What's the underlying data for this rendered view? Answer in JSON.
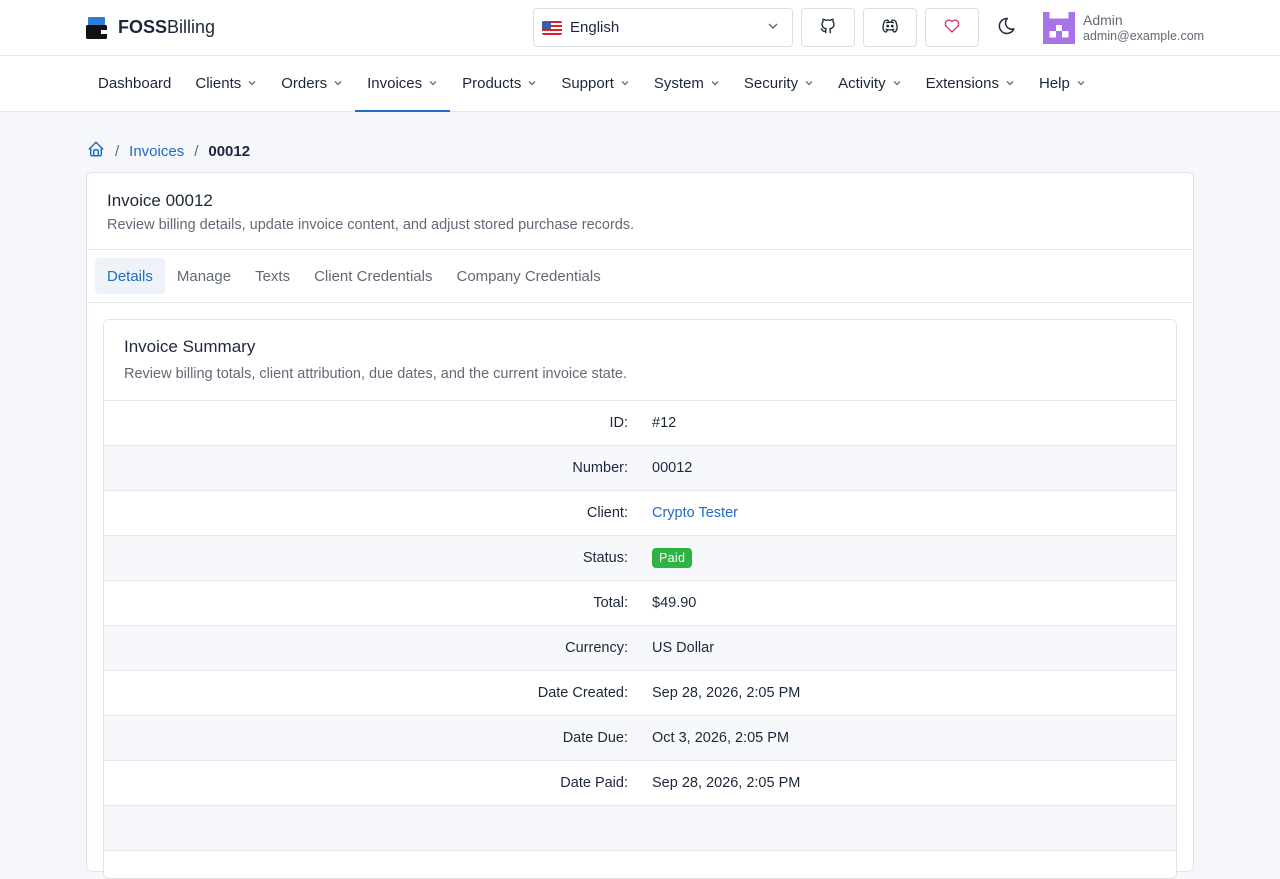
{
  "brand": {
    "bold": "FOSS",
    "rest": "Billing"
  },
  "header": {
    "language": "English",
    "user_name": "Admin",
    "user_email": "admin@example.com"
  },
  "nav": [
    {
      "label": "Dashboard",
      "dropdown": false
    },
    {
      "label": "Clients",
      "dropdown": true
    },
    {
      "label": "Orders",
      "dropdown": true
    },
    {
      "label": "Invoices",
      "dropdown": true,
      "active": true
    },
    {
      "label": "Products",
      "dropdown": true
    },
    {
      "label": "Support",
      "dropdown": true
    },
    {
      "label": "System",
      "dropdown": true
    },
    {
      "label": "Security",
      "dropdown": true
    },
    {
      "label": "Activity",
      "dropdown": true
    },
    {
      "label": "Extensions",
      "dropdown": true
    },
    {
      "label": "Help",
      "dropdown": true
    }
  ],
  "breadcrumb": {
    "sep": "/",
    "section": "Invoices",
    "current": "00012"
  },
  "page": {
    "title": "Invoice 00012",
    "subtitle": "Review billing details, update invoice content, and adjust stored purchase records."
  },
  "tabs": [
    "Details",
    "Manage",
    "Texts",
    "Client Credentials",
    "Company Credentials"
  ],
  "summary": {
    "title": "Invoice Summary",
    "subtitle": "Review billing totals, client attribution, due dates, and the current invoice state.",
    "rows": [
      {
        "label": "ID:",
        "value": "#12"
      },
      {
        "label": "Number:",
        "value": "00012"
      },
      {
        "label": "Client:",
        "value": "Crypto Tester",
        "link": true
      },
      {
        "label": "Status:",
        "value": "Paid",
        "badge": true
      },
      {
        "label": "Total:",
        "value": "$49.90"
      },
      {
        "label": "Currency:",
        "value": "US Dollar"
      },
      {
        "label": "Date Created:",
        "value": "Sep 28, 2026, 2:05 PM"
      },
      {
        "label": "Date Due:",
        "value": "Oct 3, 2026, 2:05 PM"
      },
      {
        "label": "Date Paid:",
        "value": "Sep 28, 2026, 2:05 PM"
      }
    ]
  },
  "colors": {
    "accent": "#206bc4",
    "success": "#2fb344",
    "background": "#f5f7fb"
  }
}
